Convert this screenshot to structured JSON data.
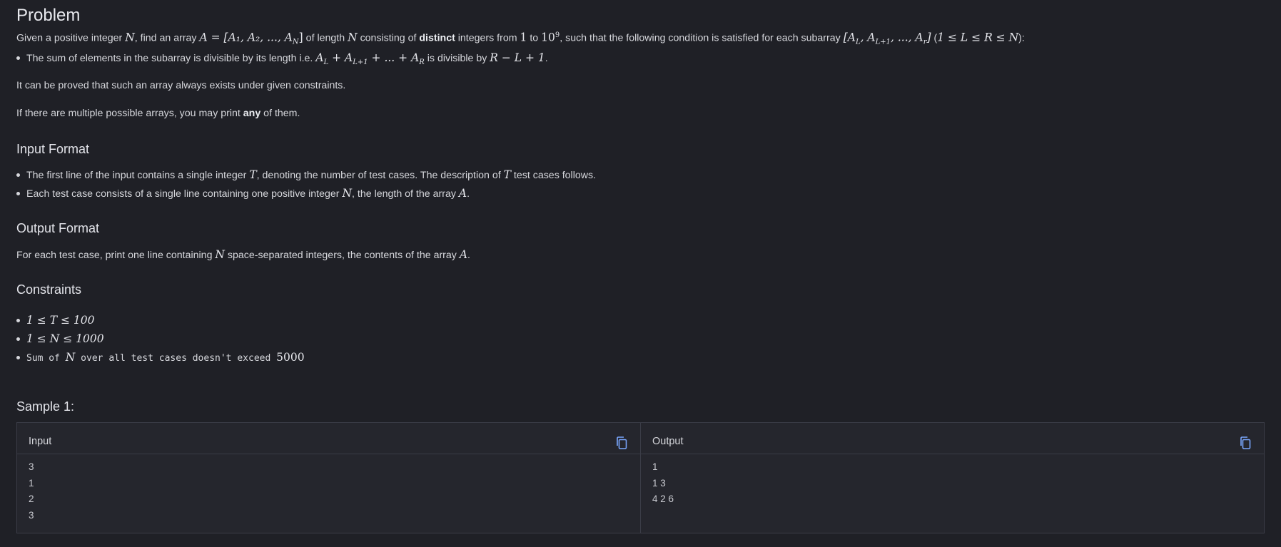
{
  "problem": {
    "title": "Problem",
    "intro": {
      "p1": "Given a positive integer ",
      "m1": "N",
      "p2": ", find an array ",
      "m2": "A = [A₁, A₂, ..., A",
      "m2sub": "N",
      "m2end": "]",
      "p3": " of length ",
      "m3": "N",
      "p4": " consisting of ",
      "bold": "distinct",
      "p5": " integers from ",
      "m4": "1",
      "p6": " to ",
      "m5": "10",
      "m5sup": "9",
      "p7": ", such that the following condition is satisfied for each subarray ",
      "m6": "[A",
      "m6sub1": "L",
      "m6mid": ", A",
      "m6sub2": "L+1",
      "m6mid2": ", ..., A",
      "m6sub3": "r",
      "m6end": "]",
      "p8": " (",
      "m7": "1 ≤ L ≤ R ≤ N",
      "p9": "):"
    },
    "condition": {
      "p1": "The sum of elements in the subarray is divisible by its length i.e. ",
      "m1": "A",
      "m1sub": "L",
      "m1mid": " + A",
      "m1sub2": "L+1",
      "m1mid2": " + ... + A",
      "m1sub3": "R",
      "p2": " is divisible by ",
      "m2": "R − L + 1",
      "p3": "."
    },
    "note1": "It can be proved that such an array always exists under given constraints.",
    "note2": {
      "p1": "If there are multiple possible arrays, you may print ",
      "bold": "any",
      "p2": " of them."
    }
  },
  "input_format": {
    "title": "Input Format",
    "item1": {
      "p1": "The first line of the input contains a single integer ",
      "m1": "T",
      "p2": ", denoting the number of test cases. The description of ",
      "m2": "T",
      "p3": " test cases follows."
    },
    "item2": {
      "p1": "Each test case consists of a single line containing one positive integer ",
      "m1": "N",
      "p2": ", the length of the array ",
      "m2": "A",
      "p3": "."
    }
  },
  "output_format": {
    "title": "Output Format",
    "p1": "For each test case, print one line containing ",
    "m1": "N",
    "p2": " space-separated integers, the contents of the array ",
    "m2": "A",
    "p3": "."
  },
  "constraints": {
    "title": "Constraints",
    "c1": "1 ≤ T ≤ 100",
    "c2": "1 ≤ N ≤ 1000",
    "c3": {
      "p1": "Sum of ",
      "m1": "N",
      "p2": " over all test cases doesn't exceed ",
      "m2": "5000"
    }
  },
  "sample": {
    "title": "Sample 1:",
    "input_label": "Input",
    "output_label": "Output",
    "input_lines": [
      "3",
      "1",
      "2",
      "3"
    ],
    "output_lines": [
      "1",
      "1 3",
      "4 2 6"
    ]
  },
  "icons": {
    "copy": "copy-icon",
    "accent": "#7aa7ff"
  }
}
